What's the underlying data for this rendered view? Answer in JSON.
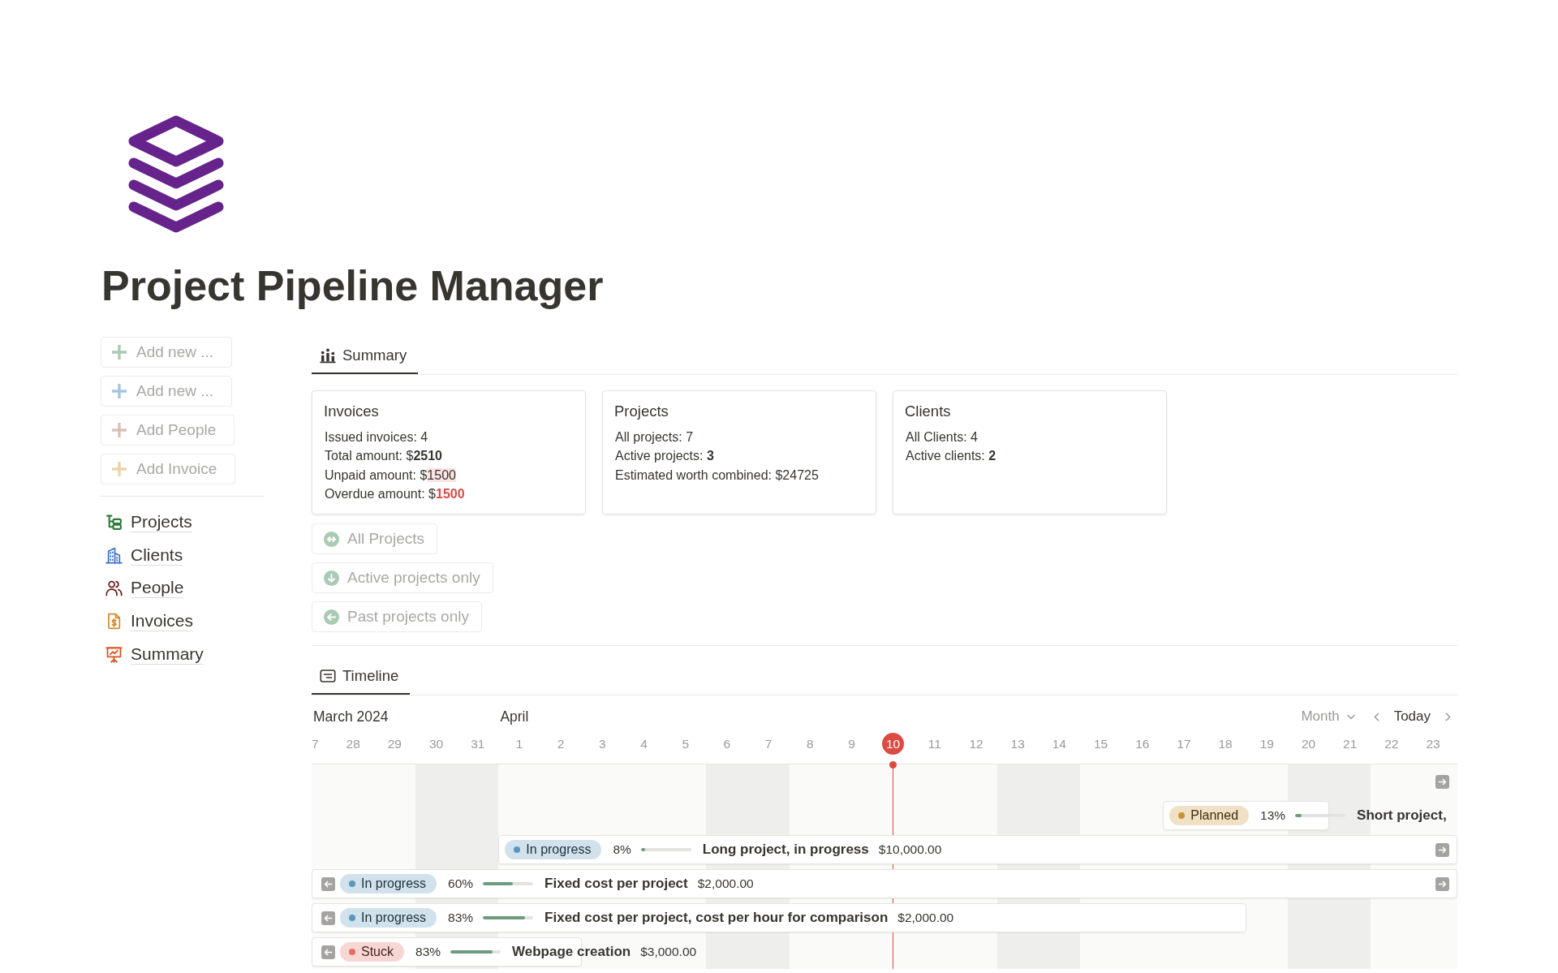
{
  "page": {
    "title": "Project Pipeline Manager"
  },
  "sidebar": {
    "buttons": [
      {
        "label": "Add new ...",
        "color": "#a9cbb3"
      },
      {
        "label": "Add new ...",
        "color": "#a6c6de"
      },
      {
        "label": "Add People",
        "color": "#d8c1b8"
      },
      {
        "label": "Add Invoice",
        "color": "#ecd4a9"
      }
    ],
    "links": [
      {
        "label": "Projects"
      },
      {
        "label": "Clients"
      },
      {
        "label": "People"
      },
      {
        "label": "Invoices"
      },
      {
        "label": "Summary"
      }
    ]
  },
  "summary": {
    "tabs": [
      {
        "label": "Summary",
        "selected": true
      }
    ],
    "cards": [
      {
        "title": "Invoices",
        "lines": [
          {
            "label": "Issued invoices:",
            "value": "4",
            "kind": "plain"
          },
          {
            "label": "Total amount:",
            "prefix": "$",
            "value": "2510",
            "kind": "bold"
          },
          {
            "label": "Unpaid amount:",
            "prefix": "$",
            "value": "1500",
            "kind": "highlight"
          },
          {
            "label": "Overdue amount:",
            "prefix": "$",
            "value": "1500",
            "kind": "alert"
          }
        ]
      },
      {
        "title": "Projects",
        "lines": [
          {
            "label": "All projects:",
            "value": "7",
            "kind": "plain"
          },
          {
            "label": "Active projects:",
            "value": "3",
            "kind": "bold"
          },
          {
            "label": "Estimated worth combined:",
            "prefix": "$",
            "value": "24725",
            "kind": "plain"
          }
        ]
      },
      {
        "title": "Clients",
        "lines": [
          {
            "label": "All Clients:",
            "value": "4",
            "kind": "plain"
          },
          {
            "label": "Active clients:",
            "value": "2",
            "kind": "bold"
          }
        ]
      }
    ],
    "filters": [
      {
        "label": "All Projects"
      },
      {
        "label": "Active projects only"
      },
      {
        "label": "Past projects only"
      }
    ]
  },
  "timeline": {
    "tabs": [
      {
        "label": "Timeline",
        "selected": true
      }
    ],
    "view": "Month",
    "today_button": "Today",
    "months": [
      {
        "label": "March 2024",
        "days": [
          {
            "label": "7",
            "weekend": false,
            "today": false
          },
          {
            "label": "28",
            "weekend": false,
            "today": false
          },
          {
            "label": "29",
            "weekend": false,
            "today": false
          },
          {
            "label": "30",
            "weekend": true,
            "today": false
          },
          {
            "label": "31",
            "weekend": true,
            "today": false
          }
        ]
      },
      {
        "label": "April",
        "days": [
          {
            "label": "1",
            "weekend": false,
            "today": false
          },
          {
            "label": "2",
            "weekend": false,
            "today": false
          },
          {
            "label": "3",
            "weekend": false,
            "today": false
          },
          {
            "label": "4",
            "weekend": false,
            "today": false
          },
          {
            "label": "5",
            "weekend": false,
            "today": false
          },
          {
            "label": "6",
            "weekend": true,
            "today": false
          },
          {
            "label": "7",
            "weekend": true,
            "today": false
          },
          {
            "label": "8",
            "weekend": false,
            "today": false
          },
          {
            "label": "9",
            "weekend": false,
            "today": false
          },
          {
            "label": "10",
            "weekend": false,
            "today": true
          },
          {
            "label": "11",
            "weekend": false,
            "today": false
          },
          {
            "label": "12",
            "weekend": false,
            "today": false
          },
          {
            "label": "13",
            "weekend": true,
            "today": false
          },
          {
            "label": "14",
            "weekend": true,
            "today": false
          },
          {
            "label": "15",
            "weekend": false,
            "today": false
          },
          {
            "label": "16",
            "weekend": false,
            "today": false
          },
          {
            "label": "17",
            "weekend": false,
            "today": false
          },
          {
            "label": "18",
            "weekend": false,
            "today": false
          },
          {
            "label": "19",
            "weekend": false,
            "today": false
          },
          {
            "label": "20",
            "weekend": true,
            "today": false
          },
          {
            "label": "21",
            "weekend": true,
            "today": false
          },
          {
            "label": "22",
            "weekend": false,
            "today": false
          },
          {
            "label": "23",
            "weekend": false,
            "today": false
          }
        ]
      }
    ],
    "rows": [
      {
        "continues_left": false,
        "continues_right": true
      },
      {
        "continues_left": false,
        "continues_right": false,
        "status": {
          "label": "Planned",
          "color": "#cb912f"
        },
        "percent": "13%",
        "level": 0.13,
        "title": "Short project,"
      },
      {
        "continues_left": false,
        "continues_right": true,
        "status": {
          "label": "In progress",
          "color": "#5b97bd"
        },
        "percent": "8%",
        "level": 0.08,
        "title": "Long project, in progress",
        "amount": "$10,000.00"
      },
      {
        "continues_left": true,
        "continues_right": true,
        "status": {
          "label": "In progress",
          "color": "#5b97bd"
        },
        "percent": "60%",
        "level": 0.6,
        "title": "Fixed cost per project",
        "amount": "$2,000.00"
      },
      {
        "continues_left": true,
        "continues_right": false,
        "status": {
          "label": "In progress",
          "color": "#5b97bd"
        },
        "percent": "83%",
        "level": 0.83,
        "title": "Fixed cost per project, cost per hour for comparison",
        "amount": "$2,000.00"
      },
      {
        "continues_left": true,
        "continues_right": false,
        "status": {
          "label": "Stuck",
          "color": "#e16f64"
        },
        "percent": "83%",
        "level": 0.83,
        "title": "Webpage creation",
        "amount": "$3,000.00"
      }
    ]
  }
}
